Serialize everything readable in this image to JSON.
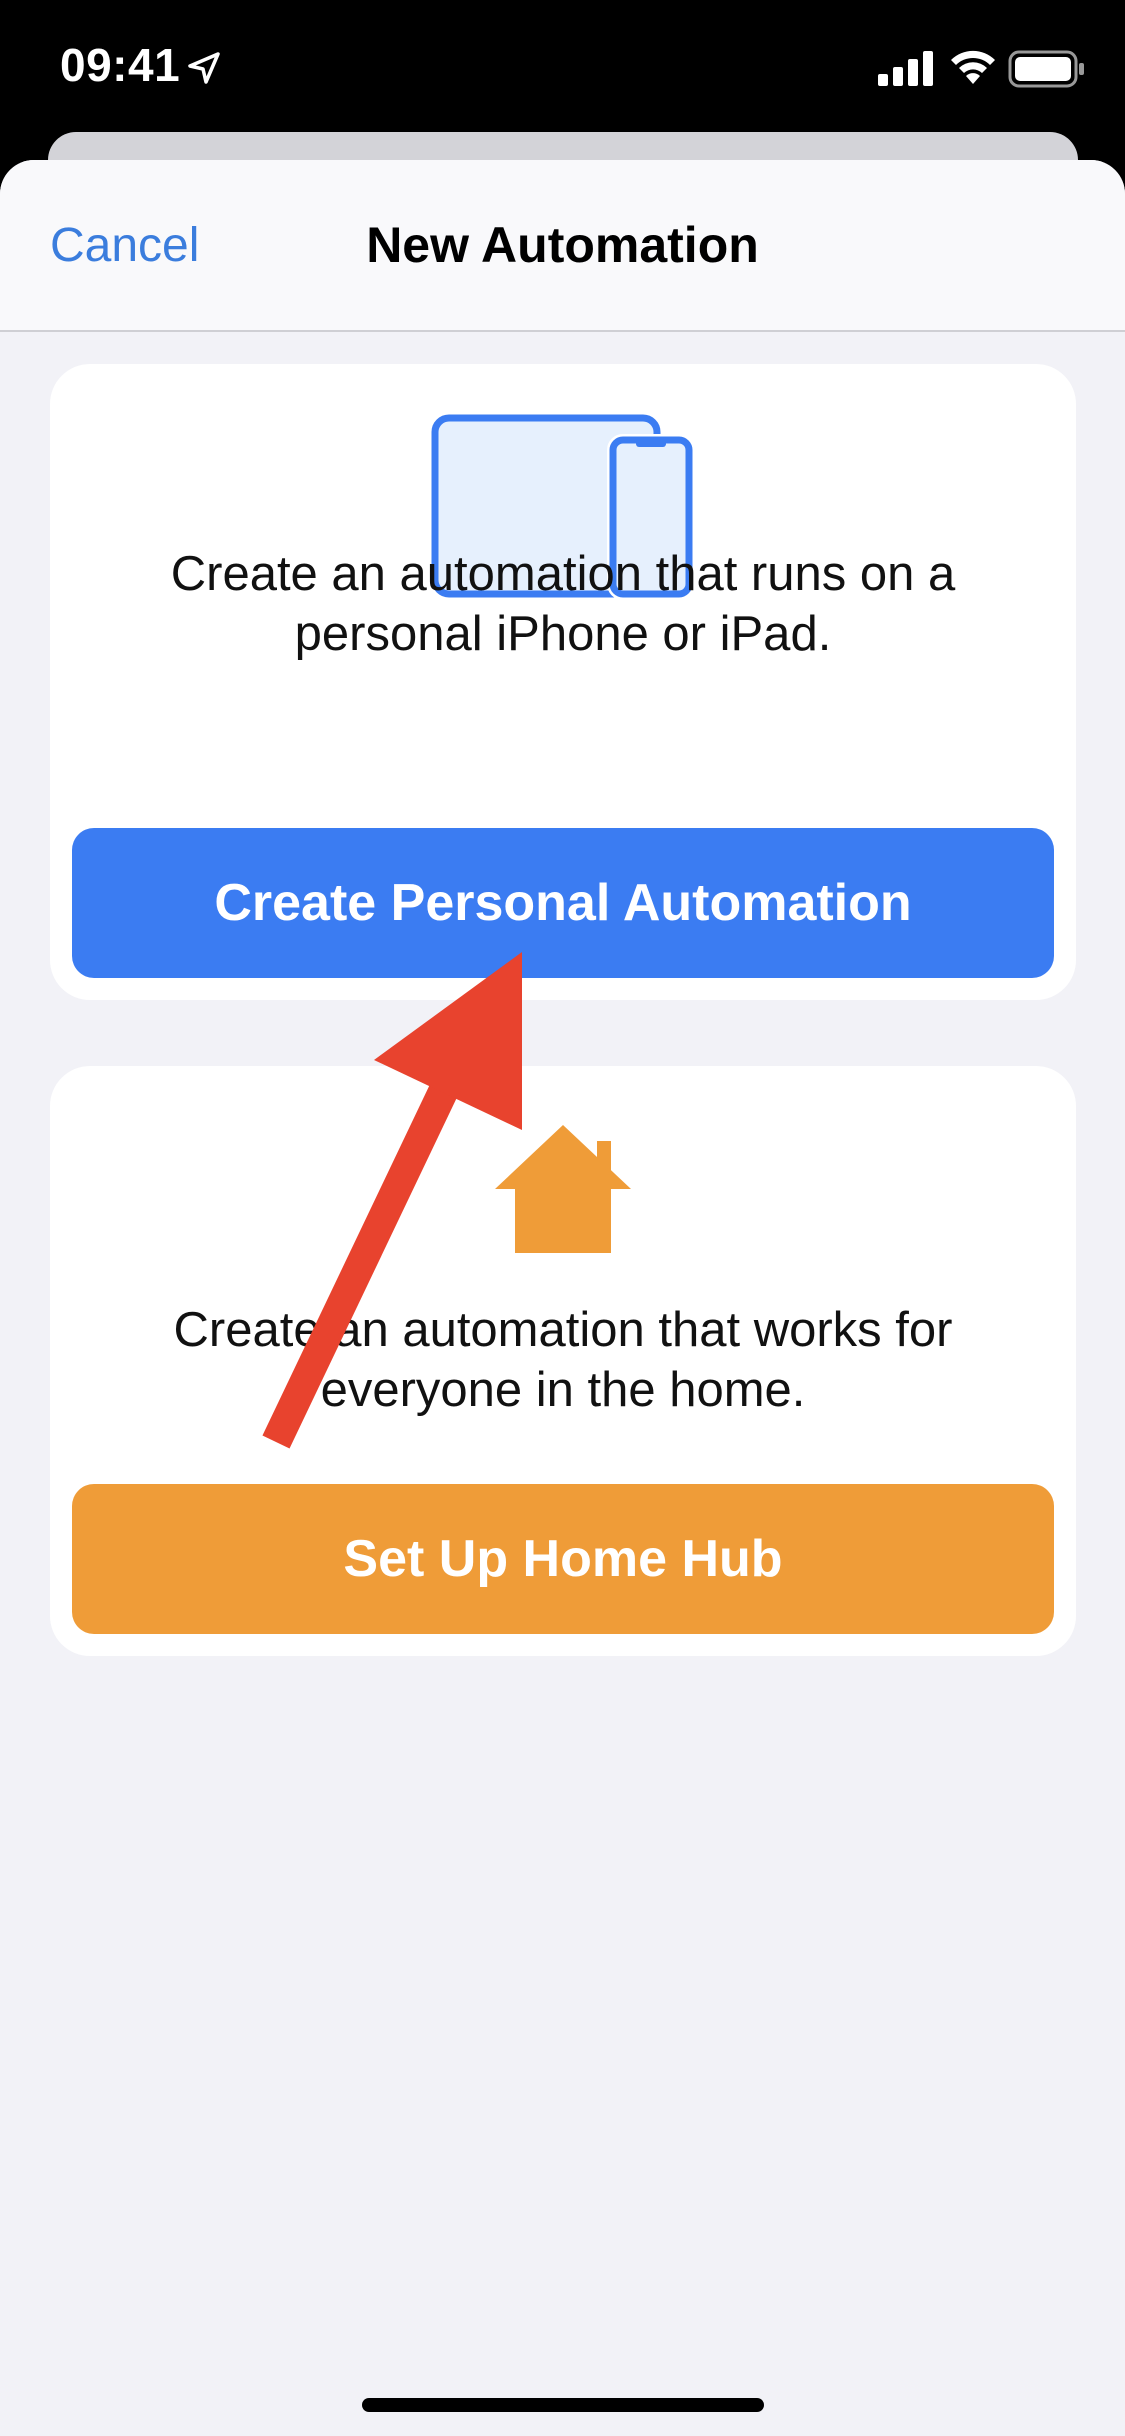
{
  "status_bar": {
    "time": "09:41",
    "icons": [
      "location-arrow-icon",
      "cellular-signal-icon",
      "wifi-icon",
      "battery-icon"
    ]
  },
  "nav": {
    "cancel_label": "Cancel",
    "title": "New Automation"
  },
  "personal_card": {
    "icon": "ipad-iphone-icon",
    "description": "Create an automation that runs on a personal iPhone or iPad.",
    "button_label": "Create Personal Automation"
  },
  "home_card": {
    "icon": "house-icon",
    "description": "Create an automation that works for everyone in the home.",
    "button_label": "Set Up Home Hub"
  },
  "colors": {
    "accent_blue": "#3b7cf2",
    "link_blue": "#3b7ddd",
    "home_orange": "#ef9c38",
    "annotation_red": "#e8432e",
    "sheet_background": "#f2f2f7"
  }
}
